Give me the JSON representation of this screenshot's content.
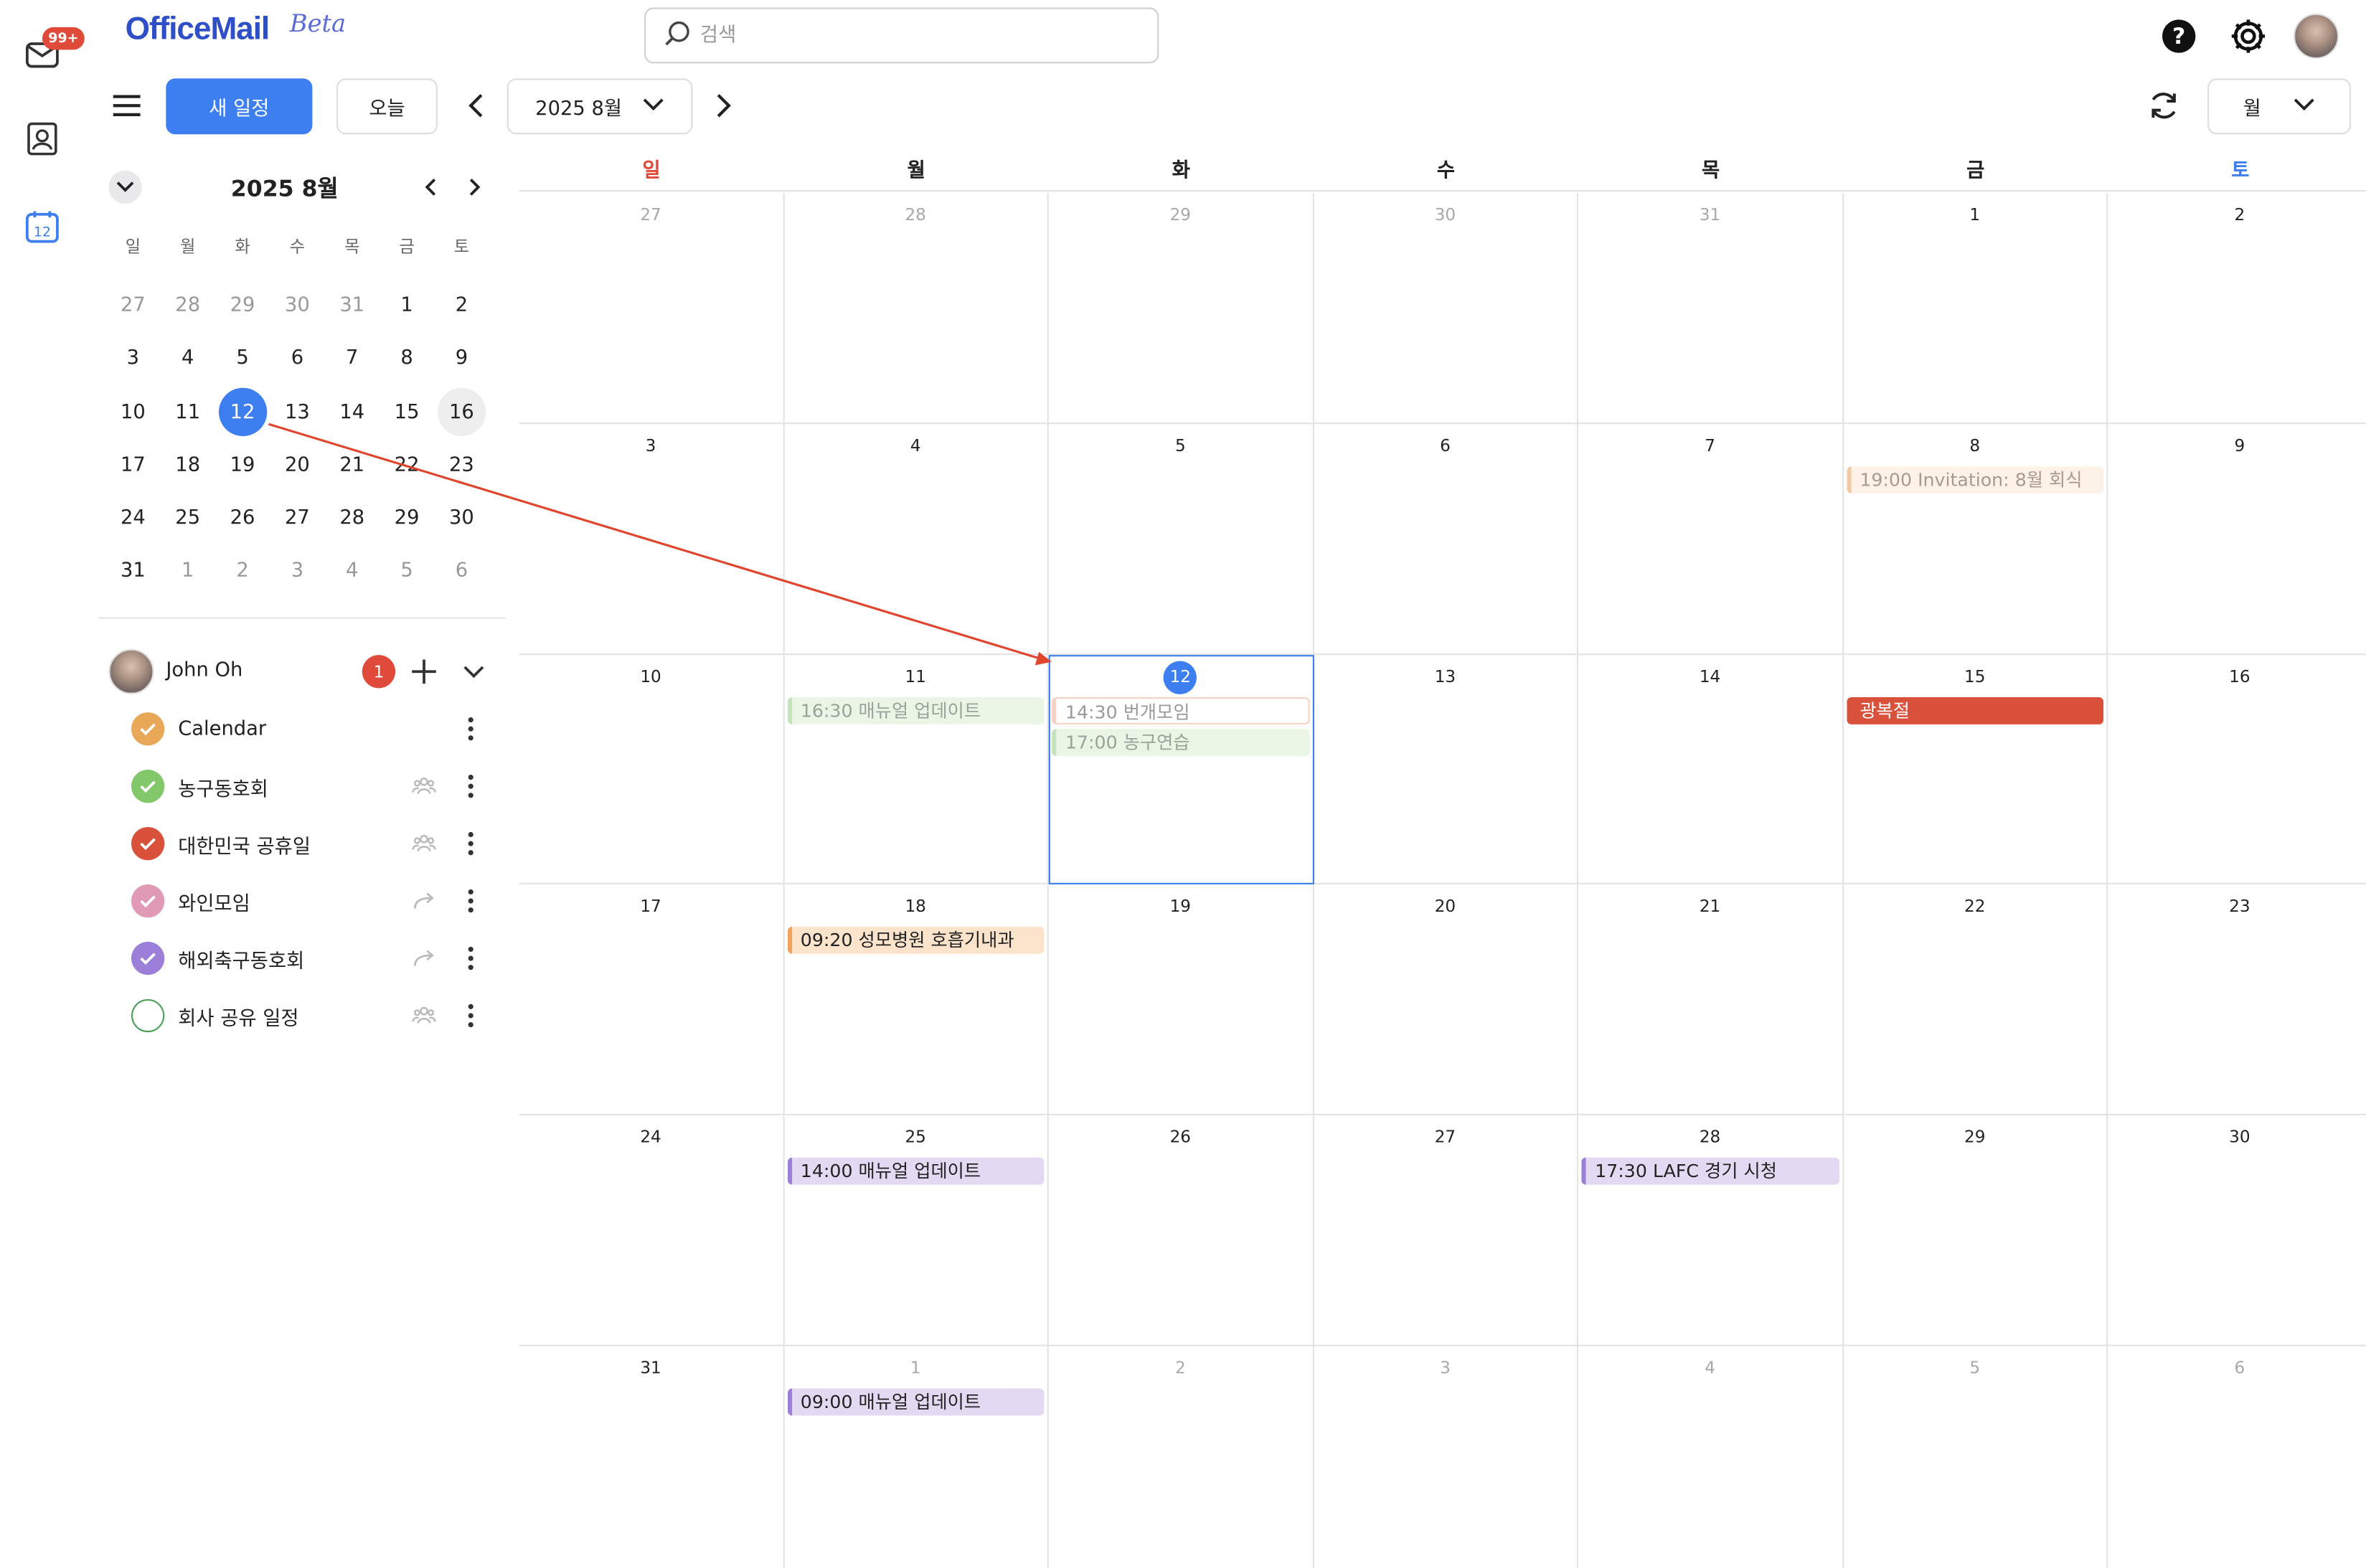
{
  "app": {
    "name": "OfficeMail",
    "beta": "Beta",
    "mail_badge": "99+"
  },
  "search": {
    "placeholder": "검색"
  },
  "toolbar": {
    "new_event": "새 일정",
    "today": "오늘",
    "month_label": "2025 8월",
    "view_label": "월"
  },
  "mini_calendar": {
    "title": "2025 8월",
    "weekdays": [
      "일",
      "월",
      "화",
      "수",
      "목",
      "금",
      "토"
    ],
    "weeks": [
      [
        "27",
        "28",
        "29",
        "30",
        "31",
        "1",
        "2"
      ],
      [
        "3",
        "4",
        "5",
        "6",
        "7",
        "8",
        "9"
      ],
      [
        "10",
        "11",
        "12",
        "13",
        "14",
        "15",
        "16"
      ],
      [
        "17",
        "18",
        "19",
        "20",
        "21",
        "22",
        "23"
      ],
      [
        "24",
        "25",
        "26",
        "27",
        "28",
        "29",
        "30"
      ],
      [
        "31",
        "1",
        "2",
        "3",
        "4",
        "5",
        "6"
      ]
    ],
    "selected": "12"
  },
  "account": {
    "name": "John Oh",
    "badge": "1"
  },
  "calendars": [
    {
      "label": "Calendar",
      "color": "#e8a857",
      "checked": true,
      "share": ""
    },
    {
      "label": "농구동호회",
      "color": "#82c76a",
      "checked": true,
      "share": "group-icon"
    },
    {
      "label": "대한민국 공휴일",
      "color": "#d9503b",
      "checked": true,
      "share": "group-icon"
    },
    {
      "label": "와인모임",
      "color": "#e09ab6",
      "checked": true,
      "share": "forward-icon"
    },
    {
      "label": "해외축구동호회",
      "color": "#9b7fd8",
      "checked": true,
      "share": "forward-icon"
    },
    {
      "label": "회사 공유 일정",
      "color": "#4ca05a",
      "checked": false,
      "share": "group-icon"
    }
  ],
  "month_view": {
    "weekdays": [
      "일",
      "월",
      "화",
      "수",
      "목",
      "금",
      "토"
    ],
    "weekday_colors": [
      "#e04a3a",
      "#222222",
      "#222222",
      "#222222",
      "#222222",
      "#222222",
      "#3d7ef0"
    ],
    "weeks": [
      [
        "27",
        "28",
        "29",
        "30",
        "31",
        "1",
        "2"
      ],
      [
        "3",
        "4",
        "5",
        "6",
        "7",
        "8",
        "9"
      ],
      [
        "10",
        "11",
        "12",
        "13",
        "14",
        "15",
        "16"
      ],
      [
        "17",
        "18",
        "19",
        "20",
        "21",
        "22",
        "23"
      ],
      [
        "24",
        "25",
        "26",
        "27",
        "28",
        "29",
        "30"
      ],
      [
        "31",
        "1",
        "2",
        "3",
        "4",
        "5",
        "6"
      ]
    ],
    "today": "12",
    "events": [
      {
        "week": 1,
        "day": 5,
        "slot": 0,
        "text": "19:00 Invitation: 8월 회식",
        "style": "faded-orange"
      },
      {
        "week": 2,
        "day": 1,
        "slot": 0,
        "text": "16:30 매뉴얼 업데이트",
        "style": "faded-green"
      },
      {
        "week": 2,
        "day": 2,
        "slot": 0,
        "text": "14:30 번개모임",
        "style": "faded-outline"
      },
      {
        "week": 2,
        "day": 2,
        "slot": 1,
        "text": "17:00 농구연습",
        "style": "faded-green"
      },
      {
        "week": 2,
        "day": 5,
        "slot": 0,
        "text": "광복절",
        "style": "holiday"
      },
      {
        "week": 3,
        "day": 1,
        "slot": 0,
        "text": "09:20 성모병원 호흡기내과",
        "style": "orange"
      },
      {
        "week": 4,
        "day": 1,
        "slot": 0,
        "text": "14:00 매뉴얼 업데이트",
        "style": "purple"
      },
      {
        "week": 4,
        "day": 4,
        "slot": 0,
        "text": "17:30 LAFC 경기 시청",
        "style": "purple"
      },
      {
        "week": 5,
        "day": 1,
        "slot": 0,
        "text": "09:00 매뉴얼 업데이트",
        "style": "purple"
      }
    ]
  },
  "colors": {
    "accent": "#3d7ef0",
    "holiday": "#d9503b",
    "arrow": "#e0452e"
  }
}
